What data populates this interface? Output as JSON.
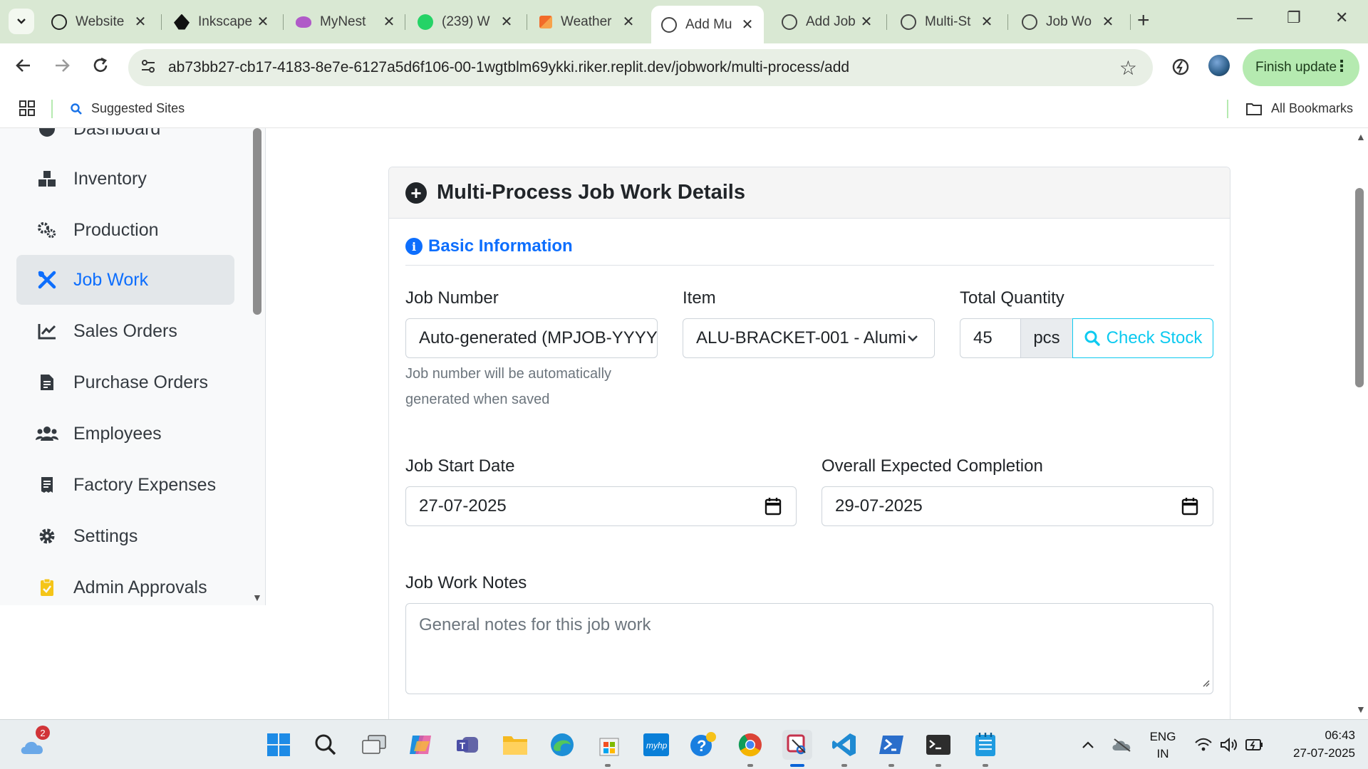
{
  "browser": {
    "tabs": [
      {
        "title": "Website",
        "icon": "openai-icon",
        "active": false
      },
      {
        "title": "Inkscape",
        "icon": "inkscape-icon",
        "active": false
      },
      {
        "title": "MyNest",
        "icon": "mynest-icon",
        "active": false
      },
      {
        "title": "(239) W",
        "icon": "whatsapp-icon",
        "active": false
      },
      {
        "title": "Weather",
        "icon": "weather-icon",
        "active": false
      },
      {
        "title": "Add Mu",
        "icon": "globe-icon",
        "active": true
      },
      {
        "title": "Add Job",
        "icon": "globe-icon",
        "active": false
      },
      {
        "title": "Multi-St",
        "icon": "globe-icon",
        "active": false
      },
      {
        "title": "Job Wo",
        "icon": "globe-icon",
        "active": false
      }
    ],
    "url": "ab73bb27-cb17-4183-8e7e-6127a5d6f106-00-1wgtblm69ykki.riker.replit.dev/jobwork/multi-process/add",
    "finish_update_label": "Finish update",
    "bookmarks": {
      "suggested": "Suggested Sites",
      "all": "All Bookmarks"
    }
  },
  "sidebar": {
    "items": [
      {
        "label": "Dashboard",
        "icon": "dashboard-icon",
        "active": false
      },
      {
        "label": "Inventory",
        "icon": "boxes-icon",
        "active": false
      },
      {
        "label": "Production",
        "icon": "gears-icon",
        "active": false
      },
      {
        "label": "Job Work",
        "icon": "tools-icon",
        "active": true
      },
      {
        "label": "Sales Orders",
        "icon": "chart-line-icon",
        "active": false
      },
      {
        "label": "Purchase Orders",
        "icon": "file-invoice-icon",
        "active": false
      },
      {
        "label": "Employees",
        "icon": "users-icon",
        "active": false
      },
      {
        "label": "Factory Expenses",
        "icon": "receipt-icon",
        "active": false
      },
      {
        "label": "Settings",
        "icon": "gear-icon",
        "active": false
      },
      {
        "label": "Admin Approvals",
        "icon": "clipboard-check-icon",
        "active": false
      }
    ]
  },
  "form": {
    "card_title": "Multi-Process Job Work Details",
    "section_title": "Basic Information",
    "job_number": {
      "label": "Job Number",
      "value": "Auto-generated (MPJOB-YYYY",
      "help": "Job number will be automatically generated when saved"
    },
    "item": {
      "label": "Item",
      "selected": "ALU-BRACKET-001 - Alumi"
    },
    "total_quantity": {
      "label": "Total Quantity",
      "value": "45",
      "unit": "pcs",
      "check_stock_label": "Check Stock"
    },
    "job_start_date": {
      "label": "Job Start Date",
      "value": "27-07-2025"
    },
    "expected_completion": {
      "label": "Overall Expected Completion",
      "value": "29-07-2025"
    },
    "notes": {
      "label": "Job Work Notes",
      "placeholder": "General notes for this job work"
    }
  },
  "taskbar": {
    "weather_badge": "2",
    "lang_line1": "ENG",
    "lang_line2": "IN",
    "time": "06:43",
    "date": "27-07-2025"
  },
  "colors": {
    "primary": "#0d6efd",
    "info": "#0dcaf0",
    "tabbar_bg": "#d9e8d3",
    "finish_update_bg": "#b5eab0"
  }
}
